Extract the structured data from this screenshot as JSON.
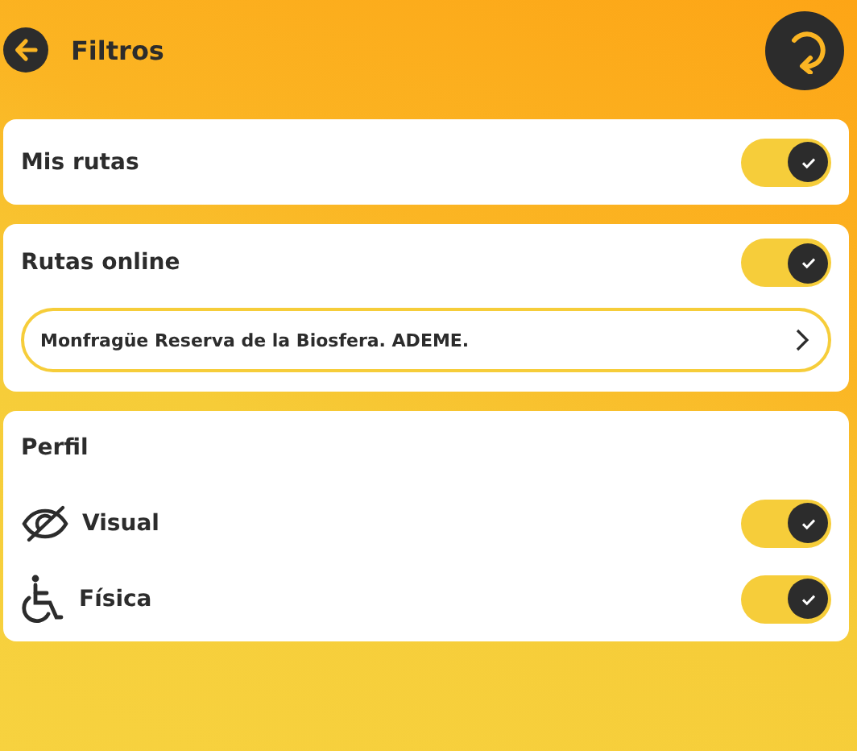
{
  "header": {
    "title": "Filtros"
  },
  "my_routes": {
    "label": "Mis rutas",
    "on": true
  },
  "online_routes": {
    "label": "Rutas online",
    "on": true,
    "selector": "Monfragüe Reserva de la Biosfera. ADEME."
  },
  "profile": {
    "title": "Perfil",
    "items": [
      {
        "kind": "visual",
        "label": "Visual",
        "on": true
      },
      {
        "kind": "physical",
        "label": "Física",
        "on": true
      }
    ]
  }
}
